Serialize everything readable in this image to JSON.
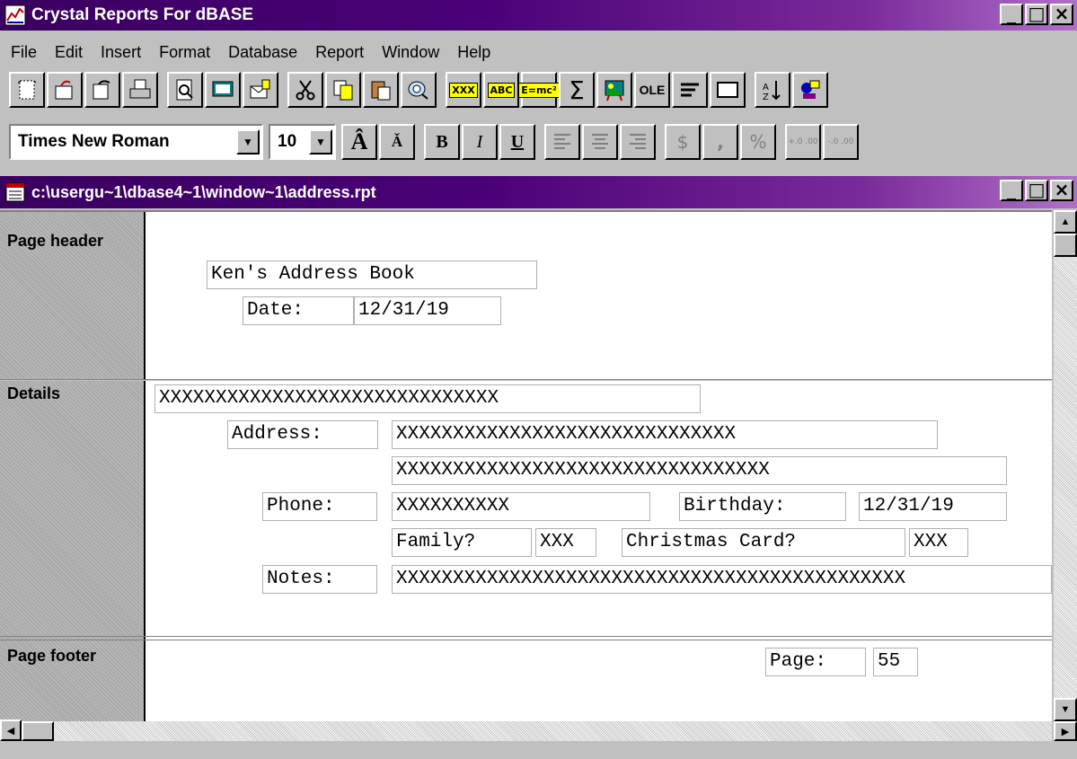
{
  "app": {
    "title": "Crystal Reports For dBASE",
    "window_buttons": [
      "_",
      "□",
      "×"
    ]
  },
  "menu": [
    "File",
    "Edit",
    "Insert",
    "Format",
    "Database",
    "Report",
    "Window",
    "Help"
  ],
  "format_toolbar": {
    "font_name": "Times New Roman",
    "font_size": "10",
    "bold": "B",
    "italic": "I",
    "underline": "U",
    "currency": "$",
    "comma": ",",
    "percent": "%",
    "decimals_add": "+.0 .00",
    "decimals_remove": "-.0 .00"
  },
  "toolbar_labels": {
    "insert_database_field": "XXX",
    "insert_text_field": "ABC",
    "insert_formula": "E=mc²",
    "summary": "Σ",
    "ole": "OLE"
  },
  "report_window": {
    "title": "c:\\usergu~1\\dbase4~1\\window~1\\address.rpt"
  },
  "sections": {
    "page_header": "Page header",
    "details": "Details",
    "page_footer": "Page footer"
  },
  "fields": {
    "report_title": "Ken's Address Book",
    "date_label": "Date:",
    "date_value": "12/31/19",
    "name": "XXXXXXXXXXXXXXXXXXXXXXXXXXXXXX",
    "address_label": "Address:",
    "address1": "XXXXXXXXXXXXXXXXXXXXXXXXXXXXXX",
    "address2": "XXXXXXXXXXXXXXXXXXXXXXXXXXXXXXXXX",
    "phone_label": "Phone:",
    "phone_value": "XXXXXXXXXX",
    "birthday_label": "Birthday:",
    "birthday_value": "12/31/19",
    "family_label": "Family?",
    "family_value": "XXX",
    "xmas_label": "Christmas Card?",
    "xmas_value": "XXX",
    "notes_label": "Notes:",
    "notes_value": "XXXXXXXXXXXXXXXXXXXXXXXXXXXXXXXXXXXXXXXXXXXXX",
    "page_label": "Page:",
    "page_value": "55"
  }
}
